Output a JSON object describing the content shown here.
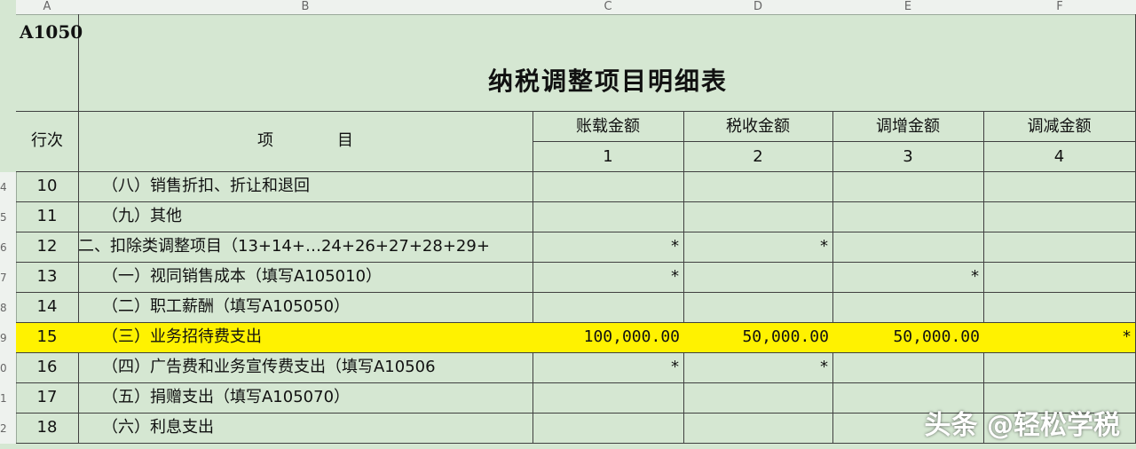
{
  "column_headers": [
    "A",
    "B",
    "C",
    "D",
    "E",
    "F"
  ],
  "row_numbers": [
    "4",
    "5",
    "6",
    "7",
    "8",
    "9",
    "0",
    "1",
    "2"
  ],
  "form_code": "A1050",
  "title": "纳税调整项目明细表",
  "header": {
    "hang_ci": "行次",
    "xiang_mu": "项　　　　目",
    "cols": [
      "账载金额",
      "税收金额",
      "调增金额",
      "调减金额"
    ],
    "col_nums": [
      "1",
      "2",
      "3",
      "4"
    ]
  },
  "rows": [
    {
      "n": "10",
      "item": "　　（八）销售折扣、折让和退回",
      "c": "",
      "d": "",
      "e": "",
      "f": ""
    },
    {
      "n": "11",
      "item": "　　（九）其他",
      "c": "",
      "d": "",
      "e": "",
      "f": ""
    },
    {
      "n": "12",
      "item": "二、扣除类调整项目（13+14+…24+26+27+28+29+",
      "c": "*",
      "d": "*",
      "e": "",
      "f": ""
    },
    {
      "n": "13",
      "item": "　　（一）视同销售成本（填写A105010）",
      "c": "*",
      "d": "",
      "e": "*",
      "f": ""
    },
    {
      "n": "14",
      "item": "　　（二）职工薪酬（填写A105050）",
      "c": "",
      "d": "",
      "e": "",
      "f": ""
    },
    {
      "n": "15",
      "item": "　　（三）业务招待费支出",
      "c": "100,000.00",
      "d": "50,000.00",
      "e": "50,000.00",
      "f": "*"
    },
    {
      "n": "16",
      "item": "　　（四）广告费和业务宣传费支出（填写A10506",
      "c": "*",
      "d": "*",
      "e": "",
      "f": ""
    },
    {
      "n": "17",
      "item": "　　（五）捐赠支出（填写A105070）",
      "c": "",
      "d": "",
      "e": "",
      "f": ""
    },
    {
      "n": "18",
      "item": "　　（六）利息支出",
      "c": "",
      "d": "",
      "e": "",
      "f": ""
    }
  ],
  "highlight_row_index": 5,
  "highlight_color": "#fff200",
  "watermark": "头条 @轻松学税"
}
